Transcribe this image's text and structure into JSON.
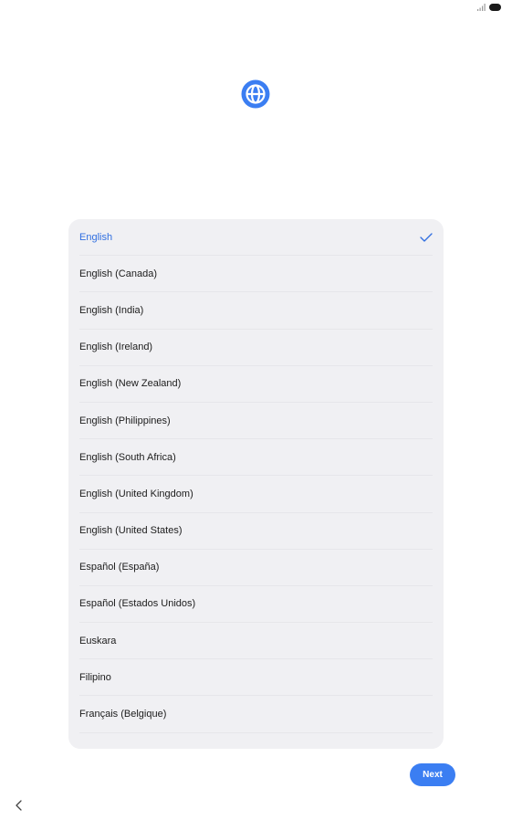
{
  "status_bar": {
    "icons": [
      "signal-icon",
      "battery-icon"
    ]
  },
  "header": {
    "icon": "globe-icon",
    "accent_color": "#3b7ef2"
  },
  "language_list": {
    "selected_color": "#2f6ee0",
    "items": [
      {
        "label": "English",
        "selected": true
      },
      {
        "label": "English (Canada)",
        "selected": false
      },
      {
        "label": "English (India)",
        "selected": false
      },
      {
        "label": "English (Ireland)",
        "selected": false
      },
      {
        "label": "English (New Zealand)",
        "selected": false
      },
      {
        "label": "English (Philippines)",
        "selected": false
      },
      {
        "label": "English (South Africa)",
        "selected": false
      },
      {
        "label": "English (United Kingdom)",
        "selected": false
      },
      {
        "label": "English (United States)",
        "selected": false
      },
      {
        "label": "Español (España)",
        "selected": false
      },
      {
        "label": "Español (Estados Unidos)",
        "selected": false
      },
      {
        "label": "Euskara",
        "selected": false
      },
      {
        "label": "Filipino",
        "selected": false
      },
      {
        "label": "Français (Belgique)",
        "selected": false
      }
    ]
  },
  "footer": {
    "next_label": "Next",
    "next_color": "#3b7ef2",
    "back_icon": "chevron-left-icon"
  }
}
